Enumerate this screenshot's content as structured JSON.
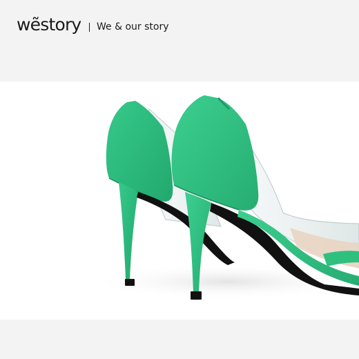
{
  "header": {
    "brand": "wẽstory",
    "divider": "|",
    "tagline": "We & our story"
  },
  "photo": {
    "subject": "pair-of-green-suede-pumps-with-clear-pvc-sides",
    "colors": {
      "suede": "#2fbf7f",
      "suede_shadow": "#22a06a",
      "sole": "#111111",
      "insole": "#e9d4bf",
      "pvc": "#d9e6e6",
      "background": "#ffffff"
    }
  }
}
